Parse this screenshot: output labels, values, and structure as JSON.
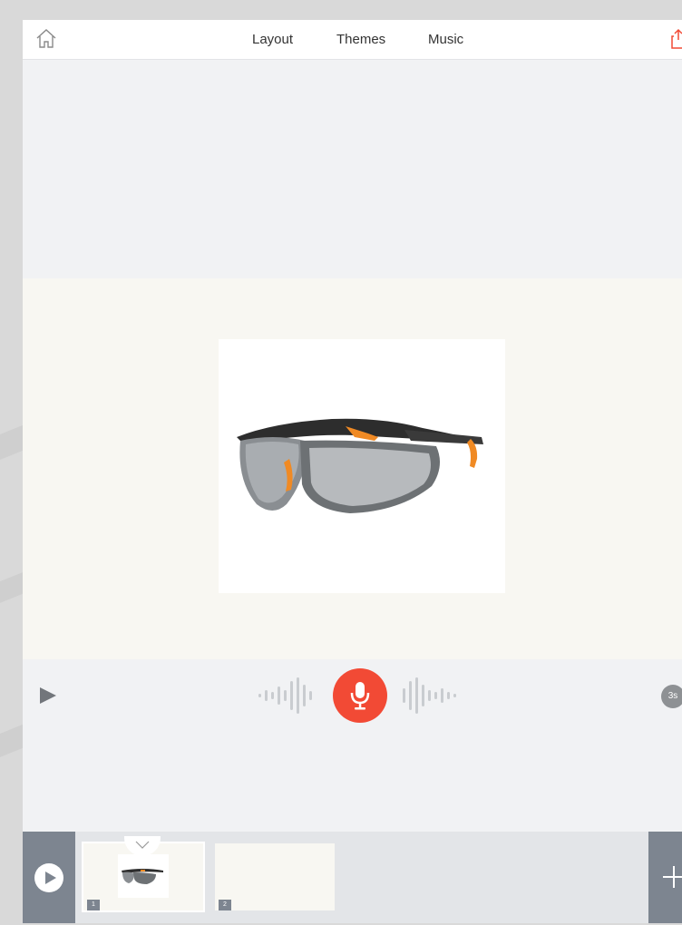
{
  "colors": {
    "accent_red": "#f24a35",
    "sidebar_gray": "#7d8590",
    "page_bg": "#f1f2f4",
    "stage_bg": "#f8f7f2"
  },
  "header": {
    "home_icon": "home-icon",
    "tabs": [
      {
        "label": "Layout"
      },
      {
        "label": "Themes"
      },
      {
        "label": "Music"
      }
    ],
    "share_icon": "share-icon"
  },
  "stage": {
    "photo_icon": "safety-glasses-photo"
  },
  "controls": {
    "play_icon": "play-icon",
    "record_icon": "microphone-icon",
    "duration": "3s"
  },
  "timeline": {
    "play_all_icon": "play-circle-icon",
    "slides": [
      {
        "number": "1"
      },
      {
        "number": "2"
      }
    ],
    "add_icon": "plus-icon"
  }
}
